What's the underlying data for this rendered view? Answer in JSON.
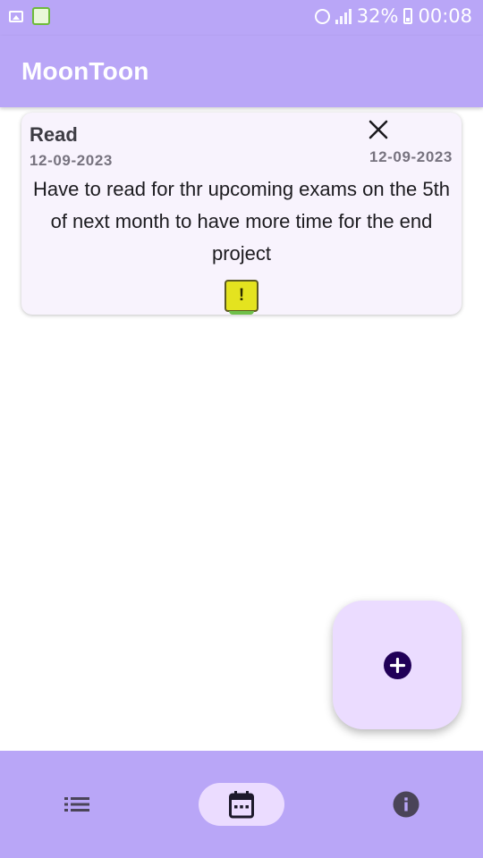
{
  "status_bar": {
    "battery_percent": "32%",
    "time": "00:08",
    "icons": [
      "image-icon",
      "app-notification-icon",
      "alarm-icon",
      "signal-icon",
      "battery-icon"
    ]
  },
  "app_bar": {
    "title": "MoonToon"
  },
  "tasks": [
    {
      "title": "Read",
      "date_left": "12-09-2023",
      "date_right": "12-09-2023",
      "description": "Have to read for thr upcoming exams on the 5th of next month to have more time for the end project",
      "priority_symbol": "!",
      "priority_color": "#e4e31f",
      "close_icon": "close-icon"
    }
  ],
  "fab": {
    "icon": "add-circle-icon"
  },
  "bottom_nav": {
    "items": [
      {
        "icon": "list-icon",
        "selected": false
      },
      {
        "icon": "calendar-icon",
        "selected": true
      },
      {
        "icon": "info-icon",
        "selected": false
      }
    ]
  },
  "colors": {
    "primary": "#b9a6f7",
    "card_background": "#f8f3fd",
    "fab_background": "#ebdcff",
    "fab_icon": "#210058",
    "nav_indicator": "#ebdcff"
  }
}
